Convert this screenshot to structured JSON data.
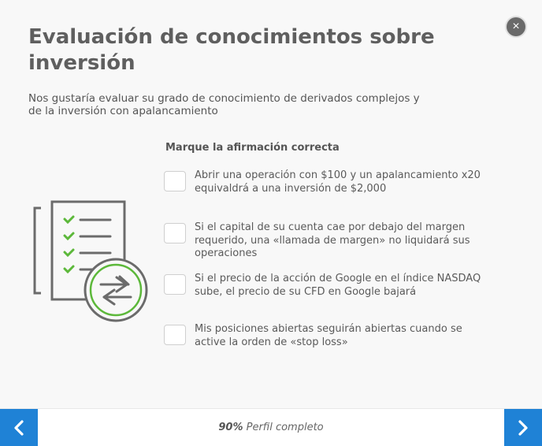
{
  "dialog": {
    "title": "Evaluación de conocimientos sobre inversión",
    "subtitle": "Nos gustaría evaluar su grado de conocimiento de derivados complejos y de la inversión con apalancamiento",
    "close_icon": "×"
  },
  "question": {
    "prompt": "Marque la afirmación correcta",
    "options": [
      {
        "text": "Abrir una operación con $100 y un apalancamiento x20 equivaldrá a una inversión de $2,000",
        "checked": false
      },
      {
        "text": "Si el capital de su cuenta cae por debajo del margen requerido, una «llamada de margen» no liquidará sus operaciones",
        "checked": false
      },
      {
        "text": "Si el precio de la acción de Google en el índice NASDAQ sube, el precio de su CFD en Google bajará",
        "checked": false
      },
      {
        "text": "Mis posiciones abiertas seguirán abiertas cuando se active la orden de «stop loss»",
        "checked": false
      }
    ]
  },
  "footer": {
    "progress_value": "90%",
    "progress_label": "Perfil completo",
    "prev_icon": "chevron-left-icon",
    "next_icon": "chevron-right-icon",
    "accent_color": "#1f82d6"
  },
  "illustration": {
    "icon": "checklist-exchange-icon",
    "check_color": "#5cb83a"
  }
}
